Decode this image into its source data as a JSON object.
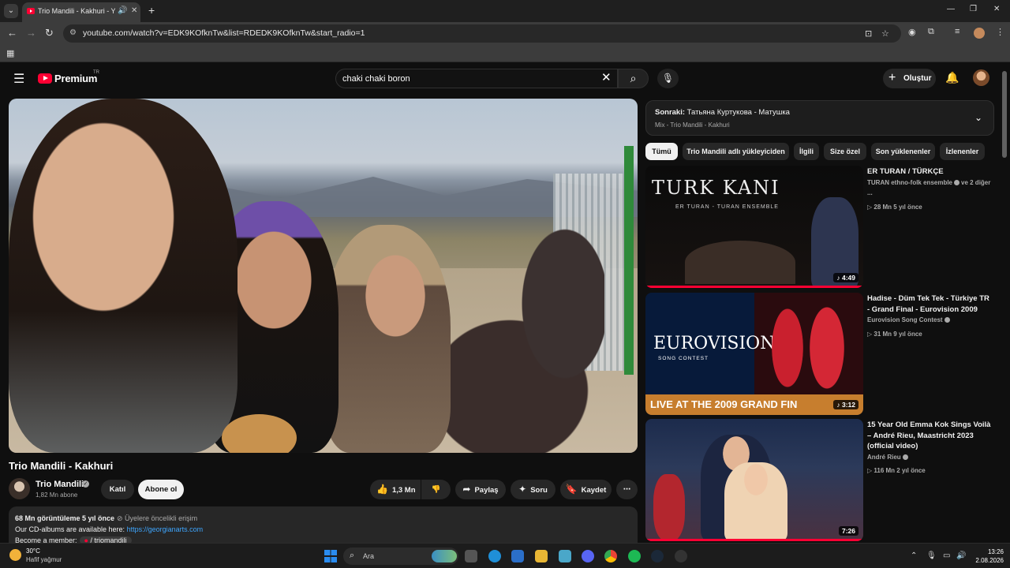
{
  "browser": {
    "tab_title": "Trio Mandili - Kakhuri - YouTube",
    "url": "youtube.com/watch?v=EDK9KOfknTw&list=RDEDK9KOfknTw&start_radio=1"
  },
  "header": {
    "brand": "Premium",
    "region": "TR",
    "search_value": "chaki chaki boron",
    "create_label": "Oluştur"
  },
  "video": {
    "title": "Trio Mandili - Kakhuri",
    "channel": "Trio Mandili",
    "subscribers": "1,82 Mn abone",
    "join_label": "Katıl",
    "subscribe_label": "Abone ol",
    "likes": "1,3 Mn",
    "share_label": "Paylaş",
    "ask_label": "Soru",
    "save_label": "Kaydet"
  },
  "description": {
    "stats": "68 Mn görüntüleme  5 yıl önce",
    "early_access": "Üyelere öncelikli erişim",
    "line2_text": "Our CD-albums are available here: ",
    "line2_link": "https://georgianarts.com",
    "line3_text": "Become a member:",
    "line3_tag": "/ triomandili"
  },
  "sidebar": {
    "next_prefix": "Sonraki:",
    "next_title": "Татьяна Куртукова - Матушка",
    "next_sub": "Mix - Trio Mandili - Kakhuri",
    "chips": [
      "Tümü",
      "Trio Mandili adlı yükleyiciden",
      "İlgili",
      "Size özel",
      "Son yüklenenler",
      "İzlenenler"
    ],
    "recommendations": [
      {
        "title": "ER TURAN / TÜRKÇE",
        "channel": "TURAN ethno-folk ensemble",
        "channel_extra": "ve 2 diğer ...",
        "meta": "28 Mn  5 yıl önce",
        "duration": "4:49",
        "thumb_text": "TURK KANI",
        "thumb_sub": "ER TURAN - TURAN ENSEMBLE",
        "watched": 1.0
      },
      {
        "title": "Hadise - Düm Tek Tek - Türkiye TR - Grand Final - Eurovision 2009",
        "channel": "Eurovision Song Contest",
        "meta": "31 Mn  9 yıl önce",
        "duration": "3:12",
        "thumb_text": "EUROVISION",
        "thumb_sub": "SONG CONTEST",
        "thumb_banner": "LIVE AT THE 2009 GRAND FIN",
        "watched": 0.0
      },
      {
        "title": "15 Year Old Emma Kok Sings Voilà – André Rieu, Maastricht 2023 (official video)",
        "channel": "André Rieu",
        "meta": "116 Mn  2 yıl önce",
        "duration": "7:26",
        "watched": 1.0
      }
    ]
  },
  "taskbar": {
    "temperature": "30°C",
    "weather": "Hafif yağmur",
    "search_label": "Ara",
    "time": "13:26",
    "date": "2.08.2026"
  },
  "colors": {
    "accent_red": "#ff0033",
    "link_blue": "#3ea6ff",
    "background": "#0f0f0f"
  }
}
